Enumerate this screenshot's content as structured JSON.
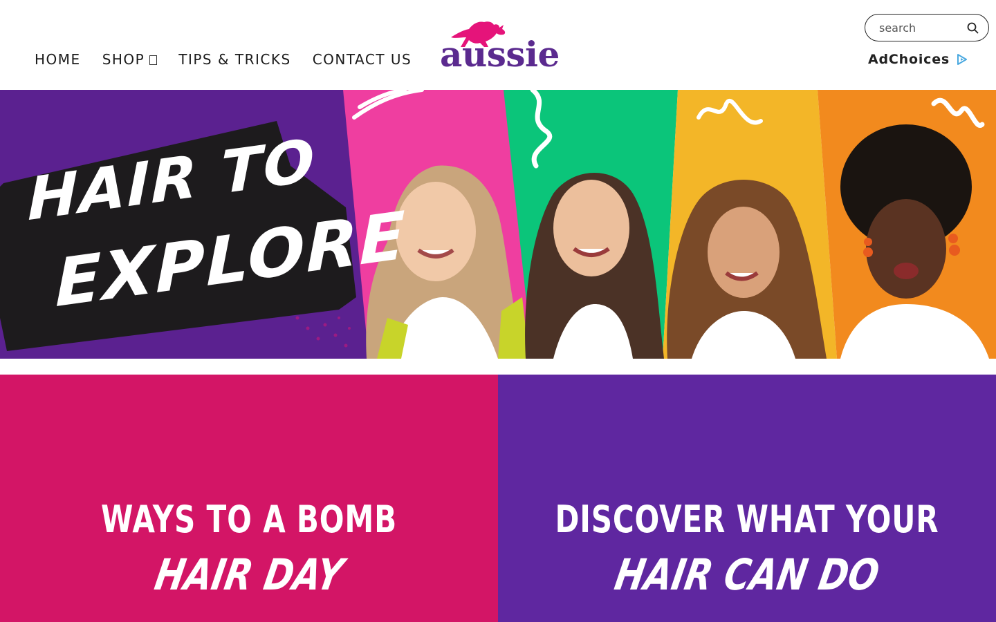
{
  "brand": {
    "name": "aussie",
    "colors": {
      "purple": "#5f27a0",
      "pink": "#d31566",
      "logo_pink": "#e5147a"
    }
  },
  "nav": {
    "items": [
      {
        "label": "HOME"
      },
      {
        "label": "SHOP",
        "has_dropdown": true
      },
      {
        "label": "TIPS & TRICKS"
      },
      {
        "label": "CONTACT US"
      }
    ]
  },
  "search": {
    "placeholder": "search"
  },
  "adchoices": {
    "label": "AdChoices"
  },
  "hero": {
    "title_line1": "HAIR TO",
    "title_line2": "EXPLORE",
    "panels": [
      "pink",
      "green",
      "yellow",
      "orange"
    ]
  },
  "promos": [
    {
      "line1": "WAYS TO A BOMB",
      "line2": "HAIR DAY",
      "color": "#d31566"
    },
    {
      "line1": "DISCOVER WHAT YOUR",
      "line2": "HAIR CAN DO",
      "color": "#5f27a0"
    }
  ]
}
